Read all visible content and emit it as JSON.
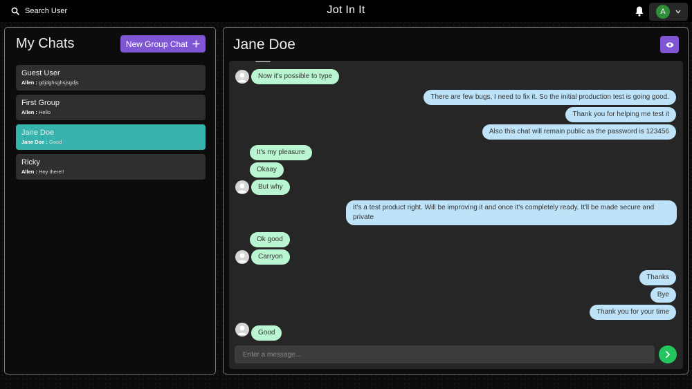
{
  "header": {
    "search_label": "Search User",
    "app_title": "Jot In It",
    "profile_initial": "A",
    "colors": {
      "background": "#000000",
      "avatar": "#2f8f3a"
    }
  },
  "sidebar": {
    "title": "My Chats",
    "new_group_label": "New Group Chat",
    "chats": [
      {
        "name": "Guest User",
        "sender": "Allen :",
        "preview": " gdjdghsghsjsgdjs",
        "selected": false
      },
      {
        "name": "First Group",
        "sender": "Allen :",
        "preview": " Hello",
        "selected": false
      },
      {
        "name": "Jane Doe",
        "sender": "Jane Doe :",
        "preview": " Good",
        "selected": true
      },
      {
        "name": "Ricky",
        "sender": "Allen :",
        "preview": " Hey there!!",
        "selected": false
      }
    ]
  },
  "conversation": {
    "title": "Jane Doe",
    "messages": [
      {
        "text": "Now it's possible to type",
        "from": "other",
        "avatar": true
      },
      {
        "text": "There are few bugs, I need to fix it. So the initial production test is going good.",
        "from": "me"
      },
      {
        "text": "Thank you for helping me test it",
        "from": "me"
      },
      {
        "text": "Also this chat will remain public as the password is 123456",
        "from": "me"
      },
      {
        "text": "It's my pleasure",
        "from": "other",
        "avatar": false
      },
      {
        "text": "Okaay",
        "from": "other",
        "avatar": false
      },
      {
        "text": "But why",
        "from": "other",
        "avatar": true
      },
      {
        "text": "It's a test product right. Will be improving it and once it's completely ready. It'll be made secure and private",
        "from": "me"
      },
      {
        "text": "Ok good",
        "from": "other",
        "avatar": false
      },
      {
        "text": "Carryon",
        "from": "other",
        "avatar": true
      },
      {
        "text": "Thanks",
        "from": "me"
      },
      {
        "text": "Bye",
        "from": "me"
      },
      {
        "text": "Thank you for your time",
        "from": "me"
      },
      {
        "text": "Good",
        "from": "other",
        "avatar": true
      }
    ],
    "input_placeholder": "Enter a message..."
  },
  "colors": {
    "accent_purple": "#7f57d4",
    "selected_chat": "#38b2ac",
    "bubble_other": "#b9f5d0",
    "bubble_mine": "#bee3f8",
    "send_button": "#22c55e"
  }
}
